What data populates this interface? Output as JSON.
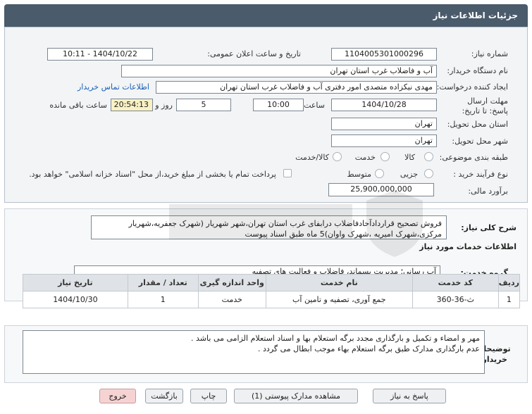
{
  "header": {
    "title": "جزئیات اطلاعات نیاز"
  },
  "form": {
    "need_number_label": "شماره نیاز:",
    "need_number": "1104005301000296",
    "announce_label": "تاریخ و ساعت اعلان عمومی:",
    "announce_value": "1404/10/22 - 10:11",
    "buyer_org_label": "نام دستگاه خریدار:",
    "buyer_org": "آب و فاضلاب غرب استان تهران",
    "creator_label": "ایجاد کننده درخواست:",
    "creator": "مهدی نیکزاده متصدی امور دفتری آب و فاضلاب غرب استان تهران",
    "contact_link": "اطلاعات تماس خریدار",
    "deadline_label": "مهلت ارسال پاسخ: تا تاریخ:",
    "deadline_date": "1404/10/28",
    "time_label": "ساعت",
    "deadline_time": "10:00",
    "days": "5",
    "days_label": "روز و",
    "remaining_time": "20:54:13",
    "remaining_label": "ساعت باقی مانده",
    "province_label": "استان محل تحویل:",
    "province": "تهران",
    "city_label": "شهر محل تحویل:",
    "city": "تهران",
    "category_label": "طبقه بندی موضوعی:",
    "category_options": [
      "کالا",
      "خدمت",
      "کالا/خدمت"
    ],
    "process_label": "نوع فرآیند خرید :",
    "process_options": [
      "جزیی",
      "متوسط"
    ],
    "payment_note": "پرداخت تمام یا بخشی از مبلغ خرید،از محل \"اسناد خزانه اسلامی\" خواهد بود.",
    "budget_label": "برآورد مالی:",
    "budget": "25,900,000,000"
  },
  "summary": {
    "label": "شرح کلی نیاز:",
    "text": "فروش تصحیح قراردادآحادفاضلاب درابفای غرب استان تهران،شهر شهریار (شهرک جعفریه،شهریار مرکزی،شهرک امیریه ،شهرک واوان)5 ماه طبق اسناد پیوست"
  },
  "services": {
    "section_title": "اطلاعات خدمات مورد نیاز",
    "group_label": "گروه خدمت:",
    "group_value": "آب رسانی؛ مدیریت پسماند، فاضلاب و فعالیت های تصفیه",
    "columns": [
      "ردیف",
      "کد خدمت",
      "نام خدمت",
      "واحد اندازه گیری",
      "تعداد / مقدار",
      "تاریخ نیاز"
    ],
    "rows": [
      [
        "1",
        "ث-36-360",
        "جمع آوری، تصفیه و تامین آب",
        "خدمت",
        "1",
        "1404/10/30"
      ]
    ]
  },
  "buyer_notes": {
    "label": "توضیحات خریدار:",
    "line1": "مهر و امضاء و تکمیل و بارگذاری مجدد برگه استعلام بها و اسناد استعلام الزامی می باشد .",
    "line2": "عدم بارگذاری مدارک طبق برگه استعلام بهاء موجب ابطال می گردد ."
  },
  "buttons": {
    "reply": "پاسخ به نیاز",
    "view_docs": "مشاهده مدارک پیوستی (1)",
    "print": "چاپ",
    "back": "بازگشت",
    "exit": "خروج"
  },
  "colors": {
    "header_bg": "#4a5b6b",
    "highlight_field": "#f9f1c4",
    "exit_button": "#f6d3d3"
  }
}
